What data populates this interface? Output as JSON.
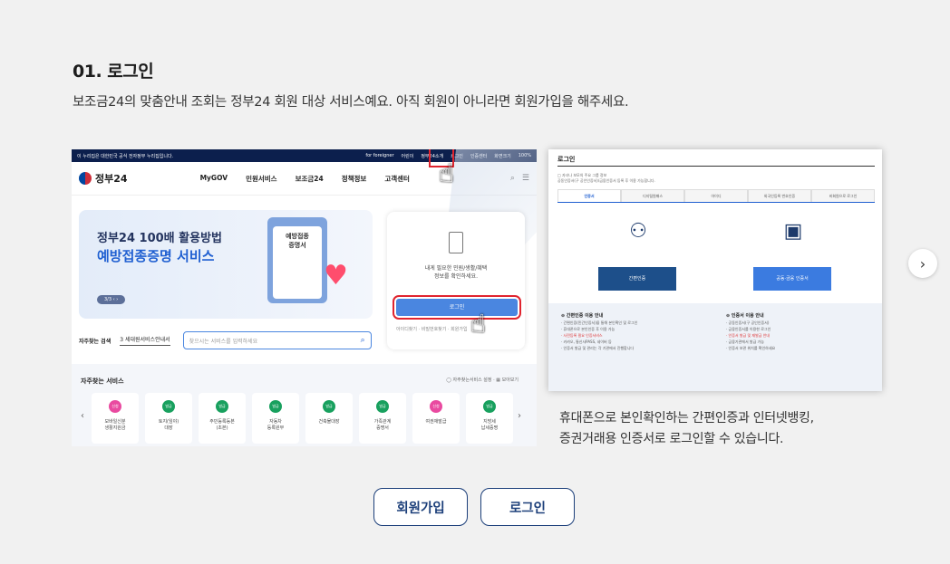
{
  "section": {
    "title": "01. 로그인",
    "description": "보조금24의 맞춤안내 조회는 정부24 회원 대상 서비스예요. 아직 회원이 아니라면 회원가입을 해주세요."
  },
  "left_shot": {
    "topbar": {
      "notice": "이 누리집은 대한민국 공식 전자정부 누리집입니다.",
      "items": [
        "for foreigner",
        "어린이",
        "정부24소개",
        "로그인",
        "인증센터",
        "화면크기",
        "100%"
      ]
    },
    "logo": "정부24",
    "menu": [
      "MyGOV",
      "민원서비스",
      "보조금24",
      "정책정보",
      "고객센터"
    ],
    "banner": {
      "line1": "정부24 100배 활용방법",
      "line2": "예방접종증명 서비스",
      "pager": "3/3 ‹ ›",
      "paper_label": "예방접종\n증명서"
    },
    "login_box": {
      "message": "내게 필요한 민원/생활/혜택\n정보를 확인하세요.",
      "button": "로그인",
      "sub": "아이디찾기 · 비밀번호찾기 · 회원가입"
    },
    "search": {
      "label": "자주찾는 검색",
      "select": "3 세대원서비스안내서",
      "placeholder": "찾으시는 서비스를 입력하세요"
    },
    "favorites": {
      "title": "자주찾는 서비스",
      "right": "◯ 자주찾는서비스 설정 · ▦ 모아보기",
      "cards": [
        {
          "badge": "신청",
          "label": "모바일신분\n생활지원금",
          "pink": true
        },
        {
          "badge": "발급",
          "label": "토지(임야)\n대장",
          "pink": false
        },
        {
          "badge": "발급",
          "label": "주민등록등본\n(초본)",
          "pink": false
        },
        {
          "badge": "발급",
          "label": "자동차\n등록원부",
          "pink": false
        },
        {
          "badge": "발급",
          "label": "건축물대장",
          "pink": false
        },
        {
          "badge": "발급",
          "label": "가족관계\n증명서",
          "pink": false
        },
        {
          "badge": "신청",
          "label": "여권재발급",
          "pink": true
        },
        {
          "badge": "발급",
          "label": "지방세\n납세증명",
          "pink": false
        }
      ]
    }
  },
  "right_shot": {
    "title": "로그인",
    "note": "□ 자녀나 보모의 주요 그룹 정보\n공동인증서(구 공인인증서)/금융인증서 등록 후 이용 가능합니다.",
    "tabs": [
      "인증서",
      "디지털원패스",
      "아이디",
      "외국인등록 번호인증",
      "비회원으로 로그인"
    ],
    "option1": "간편인증",
    "option2": "공동·금융 인증서",
    "info_left": {
      "title": "⊖ 간편인증 이용 안내",
      "lines": [
        "· 간편인증(민간인증서)을 통해 본인확인 및 로그인",
        "· 휴대폰으로 본인인증 후 이용 가능",
        "· 사전등록 필요 인증서비스",
        "· 카카오, 통신사PASS, 네이버 등",
        "· 인증서 발급 및 관리는 각 기관에서 진행합니다"
      ]
    },
    "info_right": {
      "title": "⊖ 인증서 이용 안내",
      "lines": [
        "· 공동인증서(구 공인인증서)",
        "· 금융인증서를 이용한 로그인",
        "· 인증서 발급 및 재발급 안내",
        "· 금융기관에서 발급 가능",
        "· 인증서 보관 위치를 확인하세요"
      ]
    }
  },
  "caption": {
    "line1": "휴대폰으로 본인확인하는 간편인증과 인터넷뱅킹,",
    "line2": "증권거래용 인증서로 로그인할 수 있습니다."
  },
  "buttons": {
    "signup": "회원가입",
    "login": "로그인"
  },
  "icons": {
    "next": "chevron-right-icon"
  }
}
